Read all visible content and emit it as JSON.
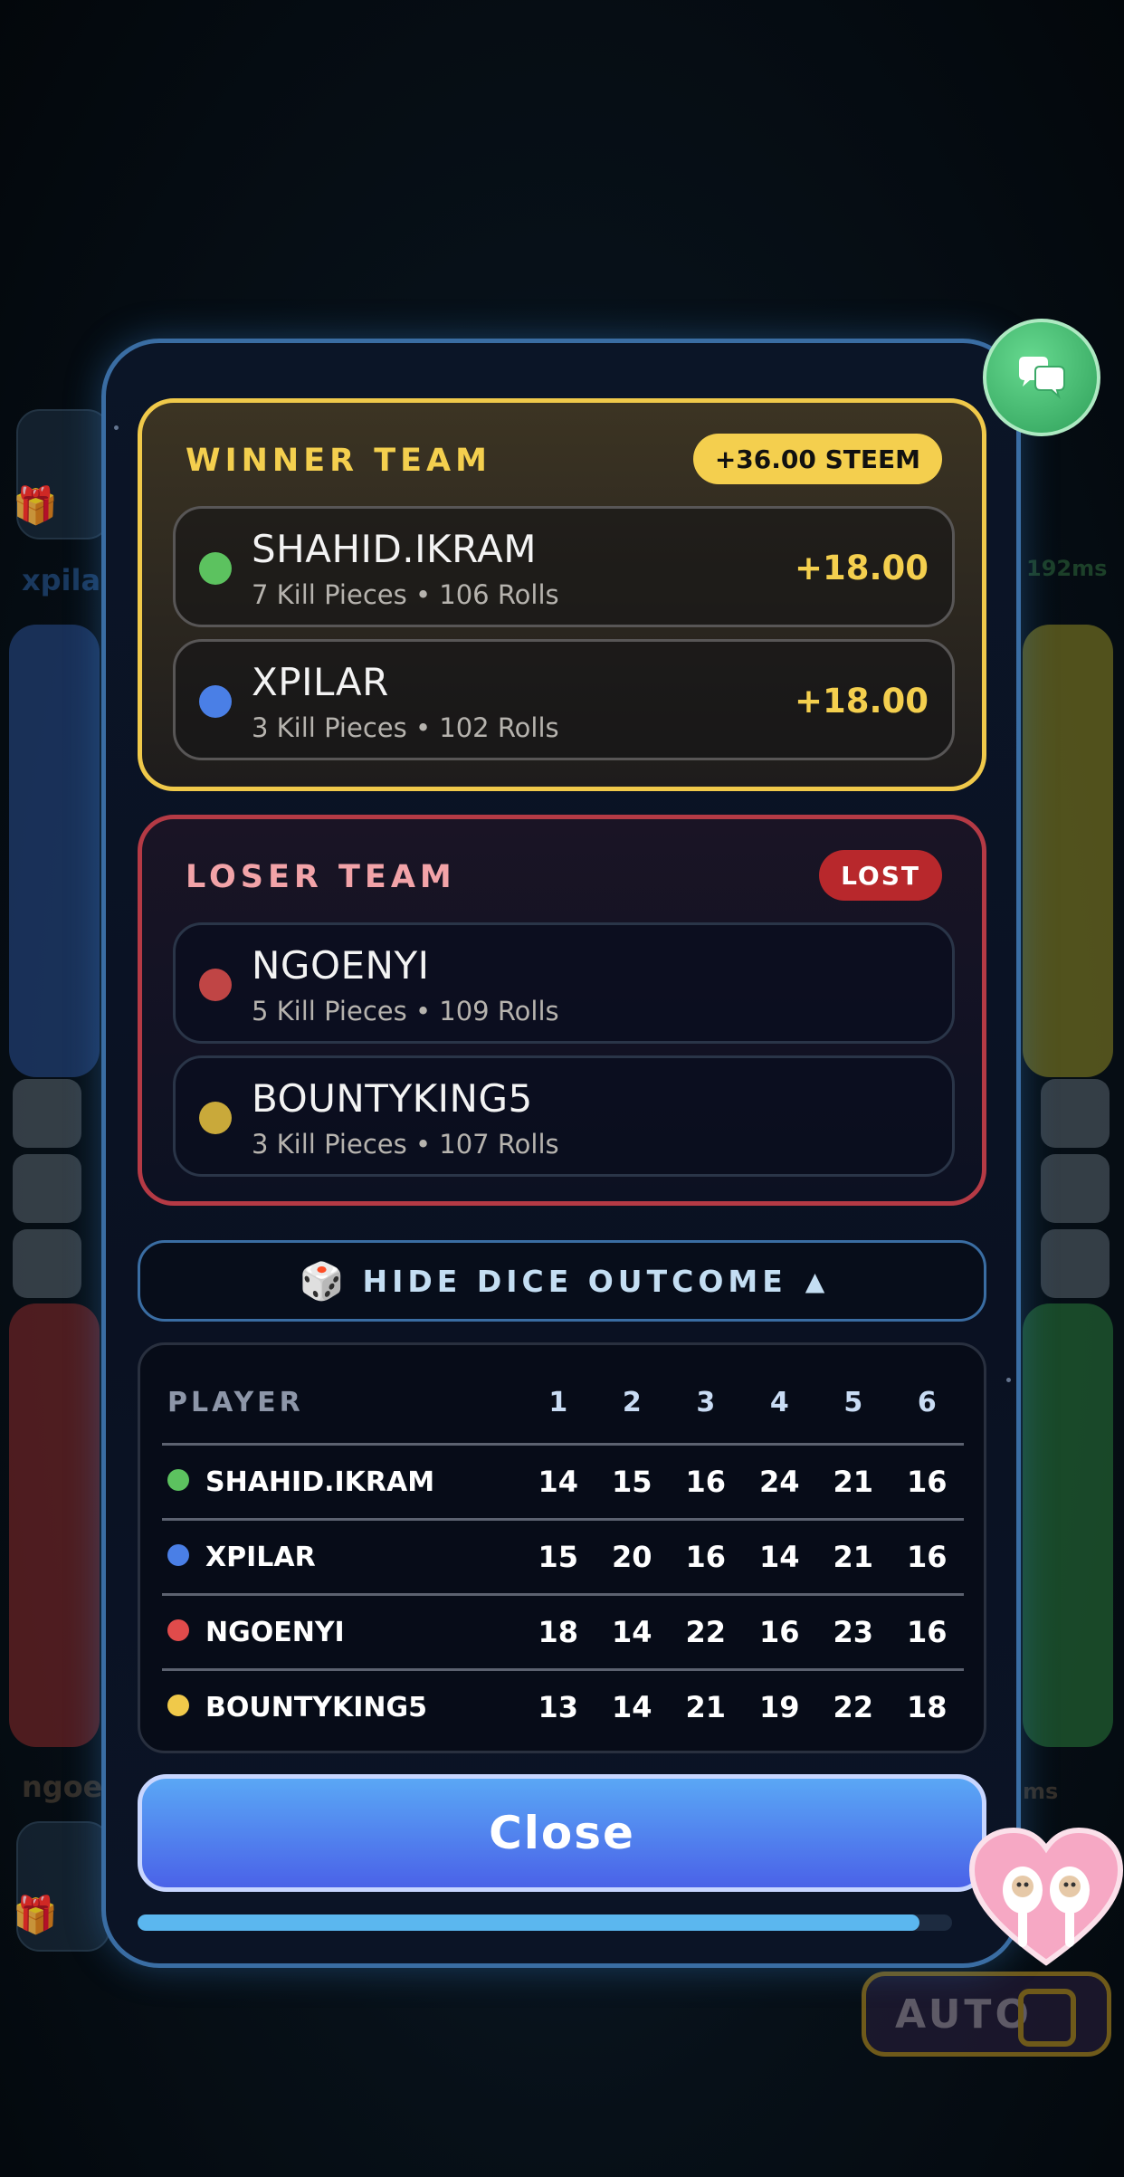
{
  "background": {
    "left_name": "xpila",
    "left_name_bottom": "ngoe",
    "right_ping": "192ms",
    "right_ping_bottom": "ms",
    "auto_label": "AUTO"
  },
  "winner_team": {
    "title": "WINNER TEAM",
    "badge": "+36.00 STEEM",
    "accent": "#f4cf4e",
    "players": [
      {
        "name": "SHAHID.IKRAM",
        "stats": "7 Kill Pieces • 106 Rolls",
        "amount": "+18.00",
        "color": "#5cc25f"
      },
      {
        "name": "XPILAR",
        "stats": "3 Kill Pieces • 102 Rolls",
        "amount": "+18.00",
        "color": "#4a7fe6"
      }
    ]
  },
  "loser_team": {
    "title": "LOSER TEAM",
    "badge": "LOST",
    "accent": "#b53a45",
    "players": [
      {
        "name": "NGOENYI",
        "stats": "5 Kill Pieces • 109 Rolls",
        "color": "#c04545"
      },
      {
        "name": "BOUNTYKING5",
        "stats": "3 Kill Pieces • 107 Rolls",
        "color": "#c9a93a"
      }
    ]
  },
  "dice_toggle": {
    "icon": "dice-icon",
    "label": "HIDE DICE OUTCOME",
    "caret": "▲"
  },
  "dice_outcome": {
    "headers": [
      "PLAYER",
      "1",
      "2",
      "3",
      "4",
      "5",
      "6"
    ],
    "rows": [
      {
        "player": "SHAHID.IKRAM",
        "color": "#5cc25f",
        "counts": [
          "14",
          "15",
          "16",
          "24",
          "21",
          "16"
        ]
      },
      {
        "player": "XPILAR",
        "color": "#4a7fe6",
        "counts": [
          "15",
          "20",
          "16",
          "14",
          "21",
          "16"
        ]
      },
      {
        "player": "NGOENYI",
        "color": "#e04b4b",
        "counts": [
          "18",
          "14",
          "22",
          "16",
          "23",
          "16"
        ]
      },
      {
        "player": "BOUNTYKING5",
        "color": "#f0c94a",
        "counts": [
          "13",
          "14",
          "21",
          "19",
          "22",
          "18"
        ]
      }
    ]
  },
  "close_button": {
    "label": "Close"
  },
  "close_timer_progress": 0.96,
  "icons": {
    "chat": "chat-bubbles-icon",
    "sticker": "heart-sheep-sticker"
  }
}
